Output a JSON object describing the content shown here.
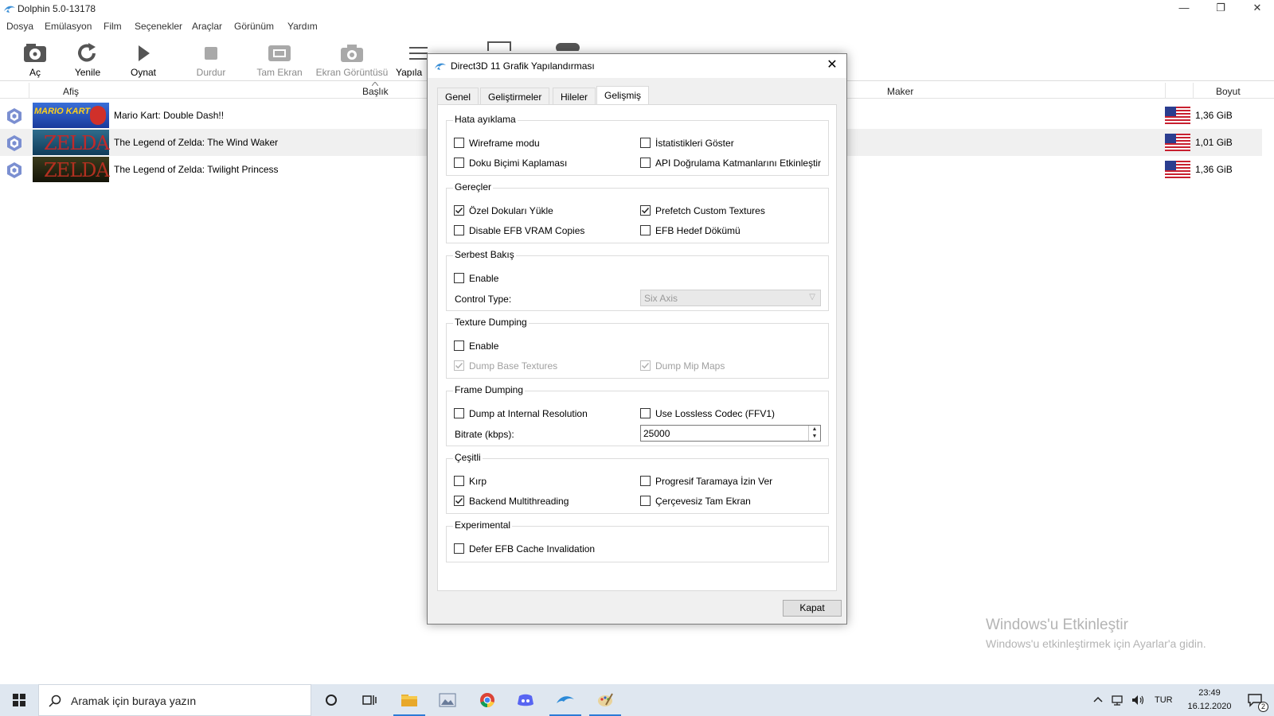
{
  "window": {
    "title": "Dolphin 5.0-13178",
    "minimize": "—",
    "restore": "❐",
    "close": "✕"
  },
  "menu": [
    "Dosya",
    "Emülasyon",
    "Film",
    "Seçenekler",
    "Araçlar",
    "Görünüm",
    "Yardım"
  ],
  "toolbar": {
    "open": "Aç",
    "refresh": "Yenile",
    "play": "Oynat",
    "stop": "Durdur",
    "fullscreen": "Tam Ekran",
    "screenshot": "Ekran Görüntüsü",
    "config": "Yapıla"
  },
  "gamelist": {
    "columns": {
      "banner": "Afiş",
      "title": "Başlık",
      "maker": "Maker",
      "size": "Boyut"
    },
    "rows": [
      {
        "title": "Mario Kart: Double Dash!!",
        "size": "1,36 GiB",
        "banner": "MARIO KART"
      },
      {
        "title": "The Legend of Zelda: The Wind Waker",
        "size": "1,01 GiB",
        "banner": "ZELDA"
      },
      {
        "title": "The Legend of Zelda: Twilight Princess",
        "size": "1,36 GiB",
        "banner": "ZELDA"
      }
    ]
  },
  "dialog": {
    "title": "Direct3D 11 Grafik Yapılandırması",
    "tabs": [
      "Genel",
      "Geliştirmeler",
      "Hileler",
      "Gelişmiş"
    ],
    "active_tab": "Gelişmiş",
    "groups": {
      "debug": {
        "label": "Hata ayıklama",
        "wireframe": "Wireframe modu",
        "stats": "İstatistikleri Göster",
        "texfmt": "Doku Biçimi Kaplaması",
        "api_validation": "API Doğrulama Katmanlarını Etkinleştir"
      },
      "utility": {
        "label": "Gereçler",
        "load_custom": "Özel Dokuları Yükle",
        "prefetch": "Prefetch Custom Textures",
        "disable_efb": "Disable EFB VRAM Copies",
        "efb_dump": "EFB Hedef Dökümü"
      },
      "freelook": {
        "label": "Serbest Bakış",
        "enable": "Enable",
        "control_type_label": "Control Type:",
        "control_type_value": "Six Axis"
      },
      "texture_dumping": {
        "label": "Texture Dumping",
        "enable": "Enable",
        "base": "Dump Base Textures",
        "mips": "Dump Mip Maps"
      },
      "frame_dumping": {
        "label": "Frame Dumping",
        "internal_res": "Dump at Internal Resolution",
        "lossless": "Use Lossless Codec (FFV1)",
        "bitrate_label": "Bitrate (kbps):",
        "bitrate_value": "25000"
      },
      "misc": {
        "label": "Çeşitli",
        "crop": "Kırp",
        "progressive": "Progresif Taramaya İzin Ver",
        "backend_mt": "Backend Multithreading",
        "borderless": "Çerçevesiz Tam Ekran"
      },
      "experimental": {
        "label": "Experimental",
        "defer_efb": "Defer EFB Cache Invalidation"
      }
    },
    "checked": [
      "load_custom",
      "prefetch",
      "backend_mt",
      "base",
      "mips"
    ],
    "close_button": "Kapat"
  },
  "watermark": {
    "line1": "Windows'u Etkinleştir",
    "line2": "Windows'u etkinleştirmek için Ayarlar'a gidin."
  },
  "taskbar": {
    "search_placeholder": "Aramak için buraya yazın",
    "lang": "TUR",
    "time": "23:49",
    "date": "16.12.2020",
    "notifications": "2"
  },
  "colors": {
    "accent": "#2c7bd6",
    "taskbar": "#dfe7f0",
    "dialog_bg": "#f0f0f0"
  }
}
